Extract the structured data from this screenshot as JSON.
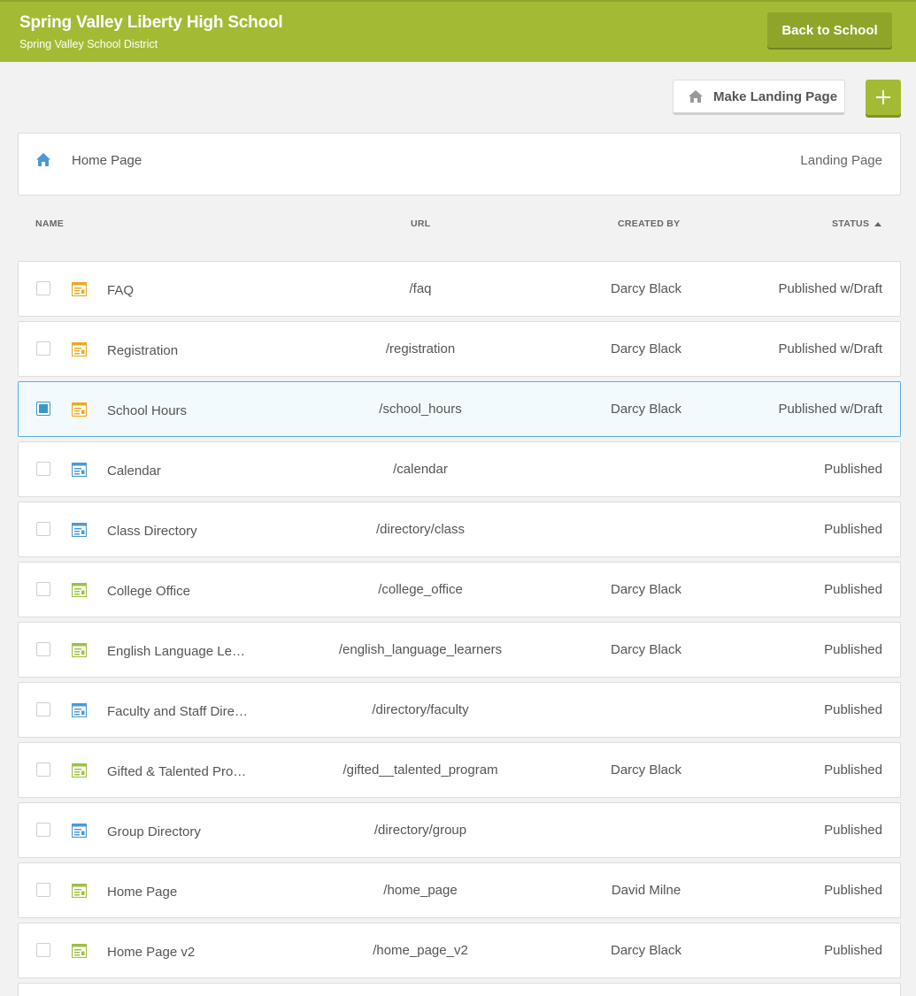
{
  "header": {
    "school_name": "Spring Valley Liberty High School",
    "district_name": "Spring Valley School District",
    "back_button": "Back to School",
    "bg_color": "#a3bb34"
  },
  "toolbar": {
    "make_landing_label": "Make Landing Page",
    "make_landing_icon": "home-icon",
    "add_icon": "plus-icon"
  },
  "landing": {
    "page_name": "Home Page",
    "badge": "Landing Page",
    "icon": "home-icon"
  },
  "columns": {
    "name": "NAME",
    "url": "URL",
    "created_by": "CREATED BY",
    "status": "STATUS",
    "status_sort": "ascending"
  },
  "colors": {
    "draft_icon": "#f0a81c",
    "directory_icon": "#4b9ad6",
    "page_icon": "#9ec042",
    "selected_accent": "#3b97c9"
  },
  "pages": [
    {
      "name": "FAQ",
      "url": "/faq",
      "created_by": "Darcy Black",
      "status": "Published w/Draft",
      "icon": "draft-page-icon",
      "selected": false
    },
    {
      "name": "Registration",
      "url": "/registration",
      "created_by": "Darcy Black",
      "status": "Published w/Draft",
      "icon": "draft-page-icon",
      "selected": false
    },
    {
      "name": "School Hours",
      "url": "/school_hours",
      "created_by": "Darcy Black",
      "status": "Published w/Draft",
      "icon": "draft-page-icon",
      "selected": true
    },
    {
      "name": "Calendar",
      "url": "/calendar",
      "created_by": "",
      "status": "Published",
      "icon": "directory-page-icon",
      "selected": false
    },
    {
      "name": "Class Directory",
      "url": "/directory/class",
      "created_by": "",
      "status": "Published",
      "icon": "directory-page-icon",
      "selected": false
    },
    {
      "name": "College Office",
      "url": "/college_office",
      "created_by": "Darcy Black",
      "status": "Published",
      "icon": "published-page-icon",
      "selected": false
    },
    {
      "name": "English Language Le…",
      "url": "/english_language_learners",
      "created_by": "Darcy Black",
      "status": "Published",
      "icon": "published-page-icon",
      "selected": false
    },
    {
      "name": "Faculty and Staff Dire…",
      "url": "/directory/faculty",
      "created_by": "",
      "status": "Published",
      "icon": "directory-page-icon",
      "selected": false
    },
    {
      "name": "Gifted & Talented Pro…",
      "url": "/gifted__talented_program",
      "created_by": "Darcy Black",
      "status": "Published",
      "icon": "published-page-icon",
      "selected": false
    },
    {
      "name": "Group Directory",
      "url": "/directory/group",
      "created_by": "",
      "status": "Published",
      "icon": "directory-page-icon",
      "selected": false
    },
    {
      "name": "Home Page",
      "url": "/home_page",
      "created_by": "David Milne",
      "status": "Published",
      "icon": "published-page-icon",
      "selected": false
    },
    {
      "name": "Home Page v2",
      "url": "/home_page_v2",
      "created_by": "Darcy Black",
      "status": "Published",
      "icon": "published-page-icon",
      "selected": false
    },
    {
      "name": "",
      "url": "",
      "created_by": "",
      "status": "",
      "icon": "",
      "selected": false
    }
  ]
}
